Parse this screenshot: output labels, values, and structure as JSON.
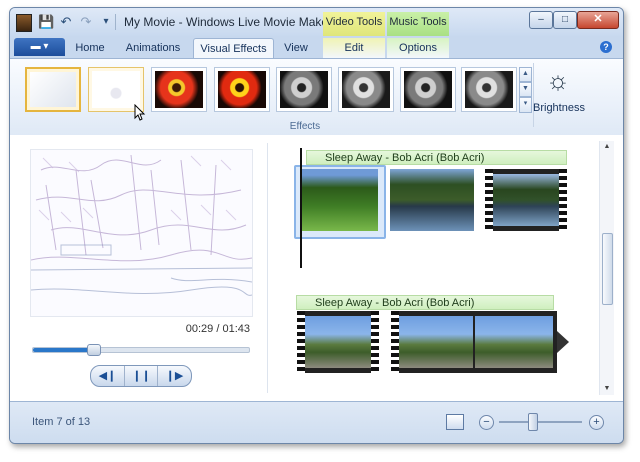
{
  "window": {
    "title": "My Movie - Windows Live Movie Maker",
    "minimize": "–",
    "maximize": "□",
    "close": "✕"
  },
  "quick_access": {
    "save_icon": "💾",
    "undo_icon": "↶",
    "redo_icon": "↷",
    "dropdown_icon": "▾"
  },
  "context_groups": [
    {
      "label": "Video Tools",
      "color": "#e9ec8a"
    },
    {
      "label": "Music Tools",
      "color": "#bfe9a0"
    }
  ],
  "app_menu": {
    "label": "▬ ▾"
  },
  "tabs": [
    "Home",
    "Animations",
    "Visual Effects",
    "View",
    "Edit",
    "Options"
  ],
  "selected_tab": "Visual Effects",
  "help": "?",
  "ribbon": {
    "gallery_up": "▲",
    "gallery_down": "▼",
    "gallery_more": "▾",
    "group_label": "Effects",
    "brightness_icon": "☼",
    "brightness_label": "Brightness"
  },
  "preview": {
    "time": "00:29 / 01:43",
    "progress": 0.28,
    "rewind": "◀❙",
    "pause": "❙❙",
    "forward": "❙▶"
  },
  "storyboard": {
    "tracks": [
      {
        "label": "Sleep Away - Bob Acri (Bob Acri)"
      },
      {
        "label": "Sleep Away - Bob Acri (Bob Acri)"
      }
    ]
  },
  "scroll": {
    "up": "▲",
    "down": "▼"
  },
  "status": {
    "item_text": "Item 7 of 13",
    "zoom_out": "−",
    "zoom_in": "+",
    "zoom_level": 0.4
  }
}
